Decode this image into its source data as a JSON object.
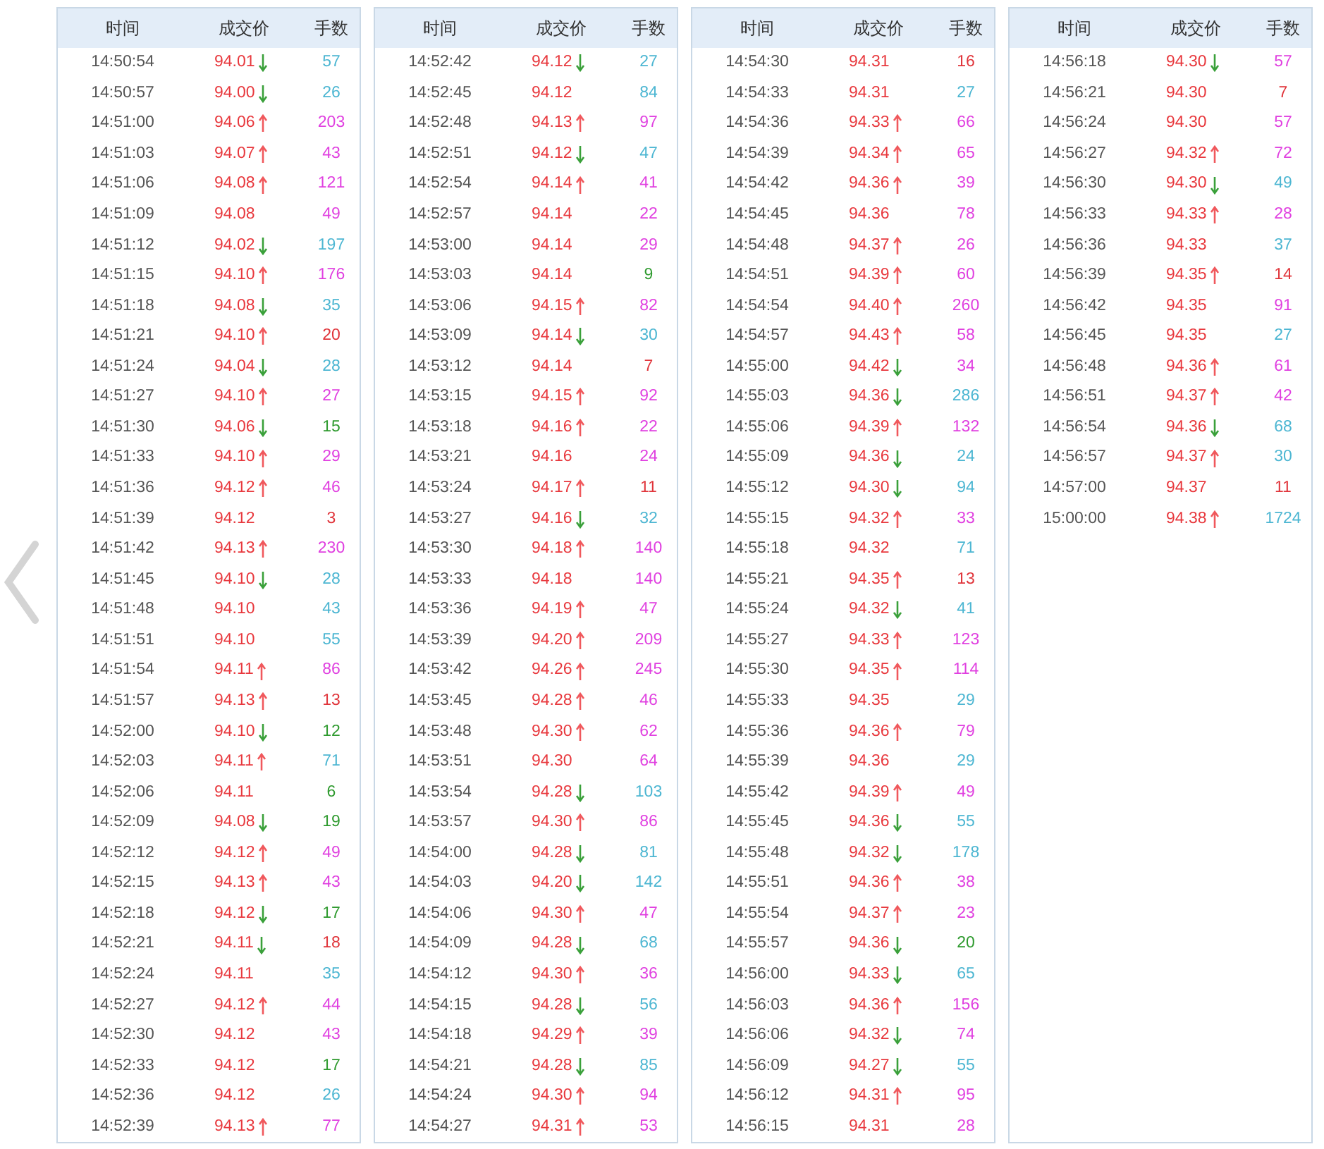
{
  "previous_button": {
    "kind": "chevron"
  },
  "tables": [
    {
      "headers": [
        "时间",
        "成交价",
        "手数"
      ],
      "rows": [
        {
          "time": "14:50:54",
          "price": "94.01",
          "kind": "down",
          "volume": "57",
          "color": "#4cb6d2"
        },
        {
          "time": "14:50:57",
          "price": "94.00",
          "kind": "down",
          "volume": "26",
          "color": "#4cb6d2"
        },
        {
          "time": "14:51:00",
          "price": "94.06",
          "kind": "up",
          "volume": "203",
          "color": "#e040e0"
        },
        {
          "time": "14:51:03",
          "price": "94.07",
          "kind": "up",
          "volume": "43",
          "color": "#e040e0"
        },
        {
          "time": "14:51:06",
          "price": "94.08",
          "kind": "up",
          "volume": "121",
          "color": "#e040e0"
        },
        {
          "time": "14:51:09",
          "price": "94.08",
          "kind": "flat",
          "volume": "49",
          "color": "#e040e0"
        },
        {
          "time": "14:51:12",
          "price": "94.02",
          "kind": "down",
          "volume": "197",
          "color": "#4cb6d2"
        },
        {
          "time": "14:51:15",
          "price": "94.10",
          "kind": "up",
          "volume": "176",
          "color": "#e040e0"
        },
        {
          "time": "14:51:18",
          "price": "94.08",
          "kind": "down",
          "volume": "35",
          "color": "#4cb6d2"
        },
        {
          "time": "14:51:21",
          "price": "94.10",
          "kind": "up",
          "volume": "20",
          "color": "#e0343a"
        },
        {
          "time": "14:51:24",
          "price": "94.04",
          "kind": "down",
          "volume": "28",
          "color": "#4cb6d2"
        },
        {
          "time": "14:51:27",
          "price": "94.10",
          "kind": "up",
          "volume": "27",
          "color": "#e040e0"
        },
        {
          "time": "14:51:30",
          "price": "94.06",
          "kind": "down",
          "volume": "15",
          "color": "#2e9a2e"
        },
        {
          "time": "14:51:33",
          "price": "94.10",
          "kind": "up",
          "volume": "29",
          "color": "#e040e0"
        },
        {
          "time": "14:51:36",
          "price": "94.12",
          "kind": "up",
          "volume": "46",
          "color": "#e040e0"
        },
        {
          "time": "14:51:39",
          "price": "94.12",
          "kind": "flat",
          "volume": "3",
          "color": "#e0343a"
        },
        {
          "time": "14:51:42",
          "price": "94.13",
          "kind": "up",
          "volume": "230",
          "color": "#e040e0"
        },
        {
          "time": "14:51:45",
          "price": "94.10",
          "kind": "down",
          "volume": "28",
          "color": "#4cb6d2"
        },
        {
          "time": "14:51:48",
          "price": "94.10",
          "kind": "flat",
          "volume": "43",
          "color": "#4cb6d2"
        },
        {
          "time": "14:51:51",
          "price": "94.10",
          "kind": "flat",
          "volume": "55",
          "color": "#4cb6d2"
        },
        {
          "time": "14:51:54",
          "price": "94.11",
          "kind": "up",
          "volume": "86",
          "color": "#e040e0"
        },
        {
          "time": "14:51:57",
          "price": "94.13",
          "kind": "up",
          "volume": "13",
          "color": "#e0343a"
        },
        {
          "time": "14:52:00",
          "price": "94.10",
          "kind": "down",
          "volume": "12",
          "color": "#2e9a2e"
        },
        {
          "time": "14:52:03",
          "price": "94.11",
          "kind": "up",
          "volume": "71",
          "color": "#4cb6d2"
        },
        {
          "time": "14:52:06",
          "price": "94.11",
          "kind": "flat",
          "volume": "6",
          "color": "#2e9a2e"
        },
        {
          "time": "14:52:09",
          "price": "94.08",
          "kind": "down",
          "volume": "19",
          "color": "#2e9a2e"
        },
        {
          "time": "14:52:12",
          "price": "94.12",
          "kind": "up",
          "volume": "49",
          "color": "#e040e0"
        },
        {
          "time": "14:52:15",
          "price": "94.13",
          "kind": "up",
          "volume": "43",
          "color": "#e040e0"
        },
        {
          "time": "14:52:18",
          "price": "94.12",
          "kind": "down",
          "volume": "17",
          "color": "#2e9a2e"
        },
        {
          "time": "14:52:21",
          "price": "94.11",
          "kind": "down",
          "volume": "18",
          "color": "#e0343a"
        },
        {
          "time": "14:52:24",
          "price": "94.11",
          "kind": "flat",
          "volume": "35",
          "color": "#4cb6d2"
        },
        {
          "time": "14:52:27",
          "price": "94.12",
          "kind": "up",
          "volume": "44",
          "color": "#e040e0"
        },
        {
          "time": "14:52:30",
          "price": "94.12",
          "kind": "flat",
          "volume": "43",
          "color": "#e040e0"
        },
        {
          "time": "14:52:33",
          "price": "94.12",
          "kind": "flat",
          "volume": "17",
          "color": "#2e9a2e"
        },
        {
          "time": "14:52:36",
          "price": "94.12",
          "kind": "flat",
          "volume": "26",
          "color": "#4cb6d2"
        },
        {
          "time": "14:52:39",
          "price": "94.13",
          "kind": "up",
          "volume": "77",
          "color": "#e040e0"
        }
      ]
    },
    {
      "headers": [
        "时间",
        "成交价",
        "手数"
      ],
      "rows": [
        {
          "time": "14:52:42",
          "price": "94.12",
          "kind": "down",
          "volume": "27",
          "color": "#4cb6d2"
        },
        {
          "time": "14:52:45",
          "price": "94.12",
          "kind": "flat",
          "volume": "84",
          "color": "#4cb6d2"
        },
        {
          "time": "14:52:48",
          "price": "94.13",
          "kind": "up",
          "volume": "97",
          "color": "#e040e0"
        },
        {
          "time": "14:52:51",
          "price": "94.12",
          "kind": "down",
          "volume": "47",
          "color": "#4cb6d2"
        },
        {
          "time": "14:52:54",
          "price": "94.14",
          "kind": "up",
          "volume": "41",
          "color": "#e040e0"
        },
        {
          "time": "14:52:57",
          "price": "94.14",
          "kind": "flat",
          "volume": "22",
          "color": "#e040e0"
        },
        {
          "time": "14:53:00",
          "price": "94.14",
          "kind": "flat",
          "volume": "29",
          "color": "#e040e0"
        },
        {
          "time": "14:53:03",
          "price": "94.14",
          "kind": "flat",
          "volume": "9",
          "color": "#2e9a2e"
        },
        {
          "time": "14:53:06",
          "price": "94.15",
          "kind": "up",
          "volume": "82",
          "color": "#e040e0"
        },
        {
          "time": "14:53:09",
          "price": "94.14",
          "kind": "down",
          "volume": "30",
          "color": "#4cb6d2"
        },
        {
          "time": "14:53:12",
          "price": "94.14",
          "kind": "flat",
          "volume": "7",
          "color": "#e0343a"
        },
        {
          "time": "14:53:15",
          "price": "94.15",
          "kind": "up",
          "volume": "92",
          "color": "#e040e0"
        },
        {
          "time": "14:53:18",
          "price": "94.16",
          "kind": "up",
          "volume": "22",
          "color": "#e040e0"
        },
        {
          "time": "14:53:21",
          "price": "94.16",
          "kind": "flat",
          "volume": "24",
          "color": "#e040e0"
        },
        {
          "time": "14:53:24",
          "price": "94.17",
          "kind": "up",
          "volume": "11",
          "color": "#e0343a"
        },
        {
          "time": "14:53:27",
          "price": "94.16",
          "kind": "down",
          "volume": "32",
          "color": "#4cb6d2"
        },
        {
          "time": "14:53:30",
          "price": "94.18",
          "kind": "up",
          "volume": "140",
          "color": "#e040e0"
        },
        {
          "time": "14:53:33",
          "price": "94.18",
          "kind": "flat",
          "volume": "140",
          "color": "#e040e0"
        },
        {
          "time": "14:53:36",
          "price": "94.19",
          "kind": "up",
          "volume": "47",
          "color": "#e040e0"
        },
        {
          "time": "14:53:39",
          "price": "94.20",
          "kind": "up",
          "volume": "209",
          "color": "#e040e0"
        },
        {
          "time": "14:53:42",
          "price": "94.26",
          "kind": "up",
          "volume": "245",
          "color": "#e040e0"
        },
        {
          "time": "14:53:45",
          "price": "94.28",
          "kind": "up",
          "volume": "46",
          "color": "#e040e0"
        },
        {
          "time": "14:53:48",
          "price": "94.30",
          "kind": "up",
          "volume": "62",
          "color": "#e040e0"
        },
        {
          "time": "14:53:51",
          "price": "94.30",
          "kind": "flat",
          "volume": "64",
          "color": "#e040e0"
        },
        {
          "time": "14:53:54",
          "price": "94.28",
          "kind": "down",
          "volume": "103",
          "color": "#4cb6d2"
        },
        {
          "time": "14:53:57",
          "price": "94.30",
          "kind": "up",
          "volume": "86",
          "color": "#e040e0"
        },
        {
          "time": "14:54:00",
          "price": "94.28",
          "kind": "down",
          "volume": "81",
          "color": "#4cb6d2"
        },
        {
          "time": "14:54:03",
          "price": "94.20",
          "kind": "down",
          "volume": "142",
          "color": "#4cb6d2"
        },
        {
          "time": "14:54:06",
          "price": "94.30",
          "kind": "up",
          "volume": "47",
          "color": "#e040e0"
        },
        {
          "time": "14:54:09",
          "price": "94.28",
          "kind": "down",
          "volume": "68",
          "color": "#4cb6d2"
        },
        {
          "time": "14:54:12",
          "price": "94.30",
          "kind": "up",
          "volume": "36",
          "color": "#e040e0"
        },
        {
          "time": "14:54:15",
          "price": "94.28",
          "kind": "down",
          "volume": "56",
          "color": "#4cb6d2"
        },
        {
          "time": "14:54:18",
          "price": "94.29",
          "kind": "up",
          "volume": "39",
          "color": "#e040e0"
        },
        {
          "time": "14:54:21",
          "price": "94.28",
          "kind": "down",
          "volume": "85",
          "color": "#4cb6d2"
        },
        {
          "time": "14:54:24",
          "price": "94.30",
          "kind": "up",
          "volume": "94",
          "color": "#e040e0"
        },
        {
          "time": "14:54:27",
          "price": "94.31",
          "kind": "up",
          "volume": "53",
          "color": "#e040e0"
        }
      ]
    },
    {
      "headers": [
        "时间",
        "成交价",
        "手数"
      ],
      "rows": [
        {
          "time": "14:54:30",
          "price": "94.31",
          "kind": "flat",
          "volume": "16",
          "color": "#e0343a"
        },
        {
          "time": "14:54:33",
          "price": "94.31",
          "kind": "flat",
          "volume": "27",
          "color": "#4cb6d2"
        },
        {
          "time": "14:54:36",
          "price": "94.33",
          "kind": "up",
          "volume": "66",
          "color": "#e040e0"
        },
        {
          "time": "14:54:39",
          "price": "94.34",
          "kind": "up",
          "volume": "65",
          "color": "#e040e0"
        },
        {
          "time": "14:54:42",
          "price": "94.36",
          "kind": "up",
          "volume": "39",
          "color": "#e040e0"
        },
        {
          "time": "14:54:45",
          "price": "94.36",
          "kind": "flat",
          "volume": "78",
          "color": "#e040e0"
        },
        {
          "time": "14:54:48",
          "price": "94.37",
          "kind": "up",
          "volume": "26",
          "color": "#e040e0"
        },
        {
          "time": "14:54:51",
          "price": "94.39",
          "kind": "up",
          "volume": "60",
          "color": "#e040e0"
        },
        {
          "time": "14:54:54",
          "price": "94.40",
          "kind": "up",
          "volume": "260",
          "color": "#e040e0"
        },
        {
          "time": "14:54:57",
          "price": "94.43",
          "kind": "up",
          "volume": "58",
          "color": "#e040e0"
        },
        {
          "time": "14:55:00",
          "price": "94.42",
          "kind": "down",
          "volume": "34",
          "color": "#e040e0"
        },
        {
          "time": "14:55:03",
          "price": "94.36",
          "kind": "down",
          "volume": "286",
          "color": "#4cb6d2"
        },
        {
          "time": "14:55:06",
          "price": "94.39",
          "kind": "up",
          "volume": "132",
          "color": "#e040e0"
        },
        {
          "time": "14:55:09",
          "price": "94.36",
          "kind": "down",
          "volume": "24",
          "color": "#4cb6d2"
        },
        {
          "time": "14:55:12",
          "price": "94.30",
          "kind": "down",
          "volume": "94",
          "color": "#4cb6d2"
        },
        {
          "time": "14:55:15",
          "price": "94.32",
          "kind": "up",
          "volume": "33",
          "color": "#e040e0"
        },
        {
          "time": "14:55:18",
          "price": "94.32",
          "kind": "flat",
          "volume": "71",
          "color": "#4cb6d2"
        },
        {
          "time": "14:55:21",
          "price": "94.35",
          "kind": "up",
          "volume": "13",
          "color": "#e0343a"
        },
        {
          "time": "14:55:24",
          "price": "94.32",
          "kind": "down",
          "volume": "41",
          "color": "#4cb6d2"
        },
        {
          "time": "14:55:27",
          "price": "94.33",
          "kind": "up",
          "volume": "123",
          "color": "#e040e0"
        },
        {
          "time": "14:55:30",
          "price": "94.35",
          "kind": "up",
          "volume": "114",
          "color": "#e040e0"
        },
        {
          "time": "14:55:33",
          "price": "94.35",
          "kind": "flat",
          "volume": "29",
          "color": "#4cb6d2"
        },
        {
          "time": "14:55:36",
          "price": "94.36",
          "kind": "up",
          "volume": "79",
          "color": "#e040e0"
        },
        {
          "time": "14:55:39",
          "price": "94.36",
          "kind": "flat",
          "volume": "29",
          "color": "#4cb6d2"
        },
        {
          "time": "14:55:42",
          "price": "94.39",
          "kind": "up",
          "volume": "49",
          "color": "#e040e0"
        },
        {
          "time": "14:55:45",
          "price": "94.36",
          "kind": "down",
          "volume": "55",
          "color": "#4cb6d2"
        },
        {
          "time": "14:55:48",
          "price": "94.32",
          "kind": "down",
          "volume": "178",
          "color": "#4cb6d2"
        },
        {
          "time": "14:55:51",
          "price": "94.36",
          "kind": "up",
          "volume": "38",
          "color": "#e040e0"
        },
        {
          "time": "14:55:54",
          "price": "94.37",
          "kind": "up",
          "volume": "23",
          "color": "#e040e0"
        },
        {
          "time": "14:55:57",
          "price": "94.36",
          "kind": "down",
          "volume": "20",
          "color": "#2e9a2e"
        },
        {
          "time": "14:56:00",
          "price": "94.33",
          "kind": "down",
          "volume": "65",
          "color": "#4cb6d2"
        },
        {
          "time": "14:56:03",
          "price": "94.36",
          "kind": "up",
          "volume": "156",
          "color": "#e040e0"
        },
        {
          "time": "14:56:06",
          "price": "94.32",
          "kind": "down",
          "volume": "74",
          "color": "#e040e0"
        },
        {
          "time": "14:56:09",
          "price": "94.27",
          "kind": "down",
          "volume": "55",
          "color": "#4cb6d2"
        },
        {
          "time": "14:56:12",
          "price": "94.31",
          "kind": "up",
          "volume": "95",
          "color": "#e040e0"
        },
        {
          "time": "14:56:15",
          "price": "94.31",
          "kind": "flat",
          "volume": "28",
          "color": "#e040e0"
        }
      ]
    },
    {
      "headers": [
        "时间",
        "成交价",
        "手数"
      ],
      "rows": [
        {
          "time": "14:56:18",
          "price": "94.30",
          "kind": "down",
          "volume": "57",
          "color": "#e040e0"
        },
        {
          "time": "14:56:21",
          "price": "94.30",
          "kind": "flat",
          "volume": "7",
          "color": "#e0343a"
        },
        {
          "time": "14:56:24",
          "price": "94.30",
          "kind": "flat",
          "volume": "57",
          "color": "#e040e0"
        },
        {
          "time": "14:56:27",
          "price": "94.32",
          "kind": "up",
          "volume": "72",
          "color": "#e040e0"
        },
        {
          "time": "14:56:30",
          "price": "94.30",
          "kind": "down",
          "volume": "49",
          "color": "#4cb6d2"
        },
        {
          "time": "14:56:33",
          "price": "94.33",
          "kind": "up",
          "volume": "28",
          "color": "#e040e0"
        },
        {
          "time": "14:56:36",
          "price": "94.33",
          "kind": "flat",
          "volume": "37",
          "color": "#4cb6d2"
        },
        {
          "time": "14:56:39",
          "price": "94.35",
          "kind": "up",
          "volume": "14",
          "color": "#e0343a"
        },
        {
          "time": "14:56:42",
          "price": "94.35",
          "kind": "flat",
          "volume": "91",
          "color": "#e040e0"
        },
        {
          "time": "14:56:45",
          "price": "94.35",
          "kind": "flat",
          "volume": "27",
          "color": "#4cb6d2"
        },
        {
          "time": "14:56:48",
          "price": "94.36",
          "kind": "up",
          "volume": "61",
          "color": "#e040e0"
        },
        {
          "time": "14:56:51",
          "price": "94.37",
          "kind": "up",
          "volume": "42",
          "color": "#e040e0"
        },
        {
          "time": "14:56:54",
          "price": "94.36",
          "kind": "down",
          "volume": "68",
          "color": "#4cb6d2"
        },
        {
          "time": "14:56:57",
          "price": "94.37",
          "kind": "up",
          "volume": "30",
          "color": "#4cb6d2"
        },
        {
          "time": "14:57:00",
          "price": "94.37",
          "kind": "flat",
          "volume": "11",
          "color": "#e0343a"
        },
        {
          "time": "15:00:00",
          "price": "94.38",
          "kind": "up",
          "volume": "1724",
          "color": "#4cb6d2"
        }
      ]
    }
  ]
}
